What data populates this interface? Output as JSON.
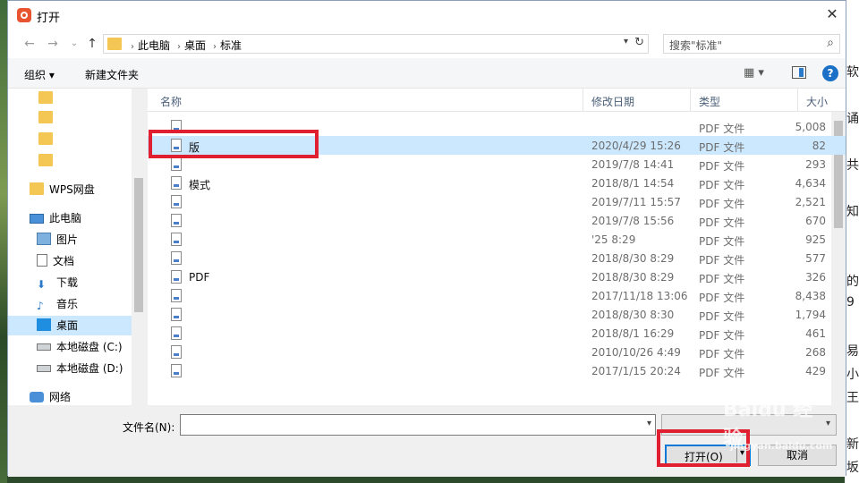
{
  "dialog": {
    "title": "打开",
    "close_glyph": "✕"
  },
  "nav": {
    "back": "←",
    "forward": "→",
    "dropdown": "⌄",
    "up": "↑",
    "breadcrumbs": [
      "此电脑",
      "桌面",
      "标准"
    ],
    "crumb_sep": "›",
    "refresh": "↻",
    "search_placeholder": "搜索\"标准\""
  },
  "toolbar": {
    "organize": "组织 ▾",
    "new_folder": "新建文件夹",
    "view_glyph": "▦ ▾",
    "help": "?"
  },
  "sidebar": {
    "items": [
      {
        "label": "",
        "icon": "folder-icon"
      },
      {
        "label": "",
        "icon": "folder-icon"
      },
      {
        "label": "",
        "icon": "folder-icon"
      },
      {
        "label": "",
        "icon": "folder-icon"
      },
      {
        "label": "WPS网盘",
        "icon": "folder-icon"
      },
      {
        "label": "此电脑",
        "icon": "pc-icon"
      },
      {
        "label": "图片",
        "icon": "pictures-icon"
      },
      {
        "label": "文档",
        "icon": "documents-icon"
      },
      {
        "label": "下载",
        "icon": "download-icon"
      },
      {
        "label": "音乐",
        "icon": "music-icon"
      },
      {
        "label": "桌面",
        "icon": "desktop-icon"
      },
      {
        "label": "本地磁盘 (C:)",
        "icon": "disk-icon"
      },
      {
        "label": "本地磁盘 (D:)",
        "icon": "disk-icon"
      },
      {
        "label": "网络",
        "icon": "network-icon"
      }
    ]
  },
  "columns": {
    "name": "名称",
    "date": "修改日期",
    "type": "类型",
    "size": "大小"
  },
  "files": [
    {
      "name": "",
      "date": "",
      "type": "PDF 文件",
      "size": "5,008"
    },
    {
      "name": "版",
      "date": "2020/4/29 15:26",
      "type": "PDF 文件",
      "size": "82"
    },
    {
      "name": "",
      "date": "2019/7/8 14:41",
      "type": "PDF 文件",
      "size": "293"
    },
    {
      "name": "模式",
      "date": "2018/8/1 14:54",
      "type": "PDF 文件",
      "size": "4,634"
    },
    {
      "name": "",
      "date": "2019/7/11 15:57",
      "type": "PDF 文件",
      "size": "2,521"
    },
    {
      "name": "",
      "date": "2019/7/8 15:56",
      "type": "PDF 文件",
      "size": "670"
    },
    {
      "name": "",
      "date": "'25 8:29",
      "type": "PDF 文件",
      "size": "925"
    },
    {
      "name": "",
      "date": "2018/8/30 8:29",
      "type": "PDF 文件",
      "size": "577"
    },
    {
      "name": "PDF",
      "date": "2018/8/30 8:29",
      "type": "PDF 文件",
      "size": "326"
    },
    {
      "name": "",
      "date": "2017/11/18 13:06",
      "type": "PDF 文件",
      "size": "8,438"
    },
    {
      "name": "",
      "date": "2018/8/30 8:30",
      "type": "PDF 文件",
      "size": "1,794"
    },
    {
      "name": "",
      "date": "2018/8/1 16:29",
      "type": "PDF 文件",
      "size": "461"
    },
    {
      "name": "",
      "date": "2010/10/26 4:49",
      "type": "PDF 文件",
      "size": "268"
    },
    {
      "name": "",
      "date": "2017/1/15 20:24",
      "type": "PDF 文件",
      "size": "429"
    }
  ],
  "bottom": {
    "filename_label": "文件名(N):",
    "filename_value": "",
    "filetype_value": "",
    "open_label": "打开(O)",
    "open_dd": "▾",
    "cancel_label": "取消",
    "dd_glyph": "▾"
  },
  "watermark": {
    "text": "Baidu 经验",
    "sub": "jingyan.baidu.com"
  },
  "background": {
    "right_chars": [
      "软",
      "",
      "诵",
      "",
      "共",
      "",
      "知",
      "",
      "",
      "的",
      "9",
      "",
      "易",
      "小",
      "王",
      "",
      "新",
      "坂"
    ]
  },
  "colors": {
    "selection": "#cce8ff",
    "highlight_box": "#e02030",
    "accent": "#0078d7"
  }
}
